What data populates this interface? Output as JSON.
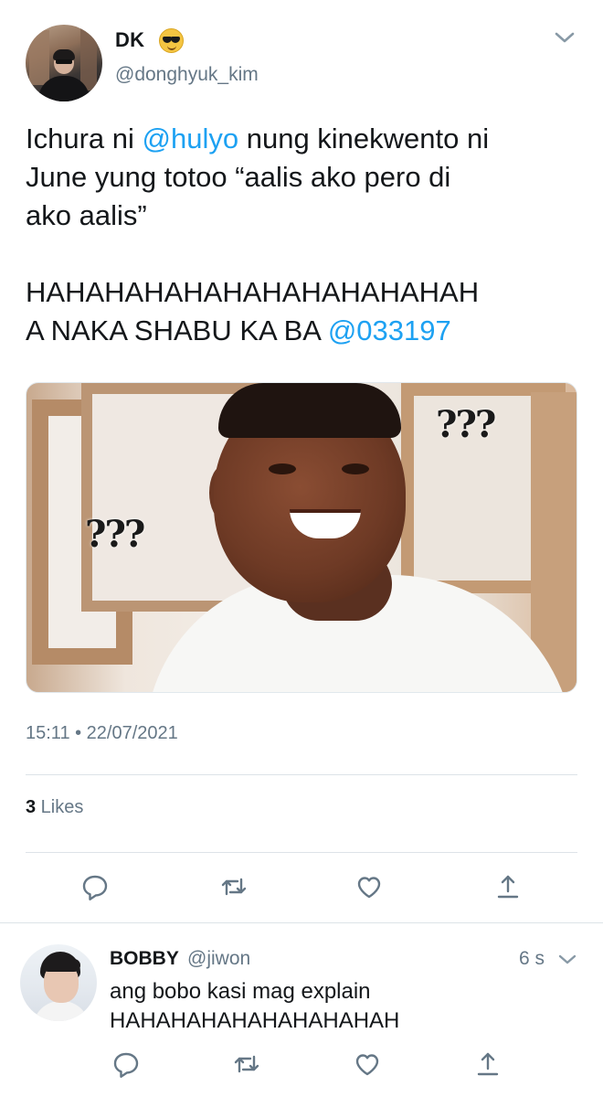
{
  "tweet": {
    "author": {
      "name": "DK",
      "emoji_icon": "smiling-face-with-sunglasses-icon",
      "handle": "@donghyuk_kim"
    },
    "text": {
      "line1_pre": "Ichura ni ",
      "line1_mention": "@hulyo",
      "line1_post": " nung kinekwento ni",
      "line2": "June yung totoo “aalis ako pero di",
      "line3": "ako aalis”",
      "line4": "HAHAHAHAHAHAHAHAHAHAHAH",
      "line5_pre": "A NAKA SHABU KA BA ",
      "line5_mention": "@033197"
    },
    "media": {
      "overlay_left": "???",
      "overlay_right": "???"
    },
    "timestamp": "15:11 • 22/07/2021",
    "likes_count": "3",
    "likes_label": " Likes",
    "actions": [
      "reply-icon",
      "retweet-icon",
      "like-icon",
      "share-icon"
    ]
  },
  "reply": {
    "name": "BOBBY",
    "handle": "@jiwon",
    "time": "6 s",
    "text_line1": "ang bobo kasi mag explain",
    "text_line2": "HAHAHAHAHAHAHAHAHAH",
    "actions": [
      "reply-icon",
      "retweet-icon",
      "like-icon",
      "share-icon"
    ]
  },
  "colors": {
    "link": "#1da1f2",
    "muted": "#657786",
    "text": "#14171a",
    "divider": "#dde3e8"
  }
}
